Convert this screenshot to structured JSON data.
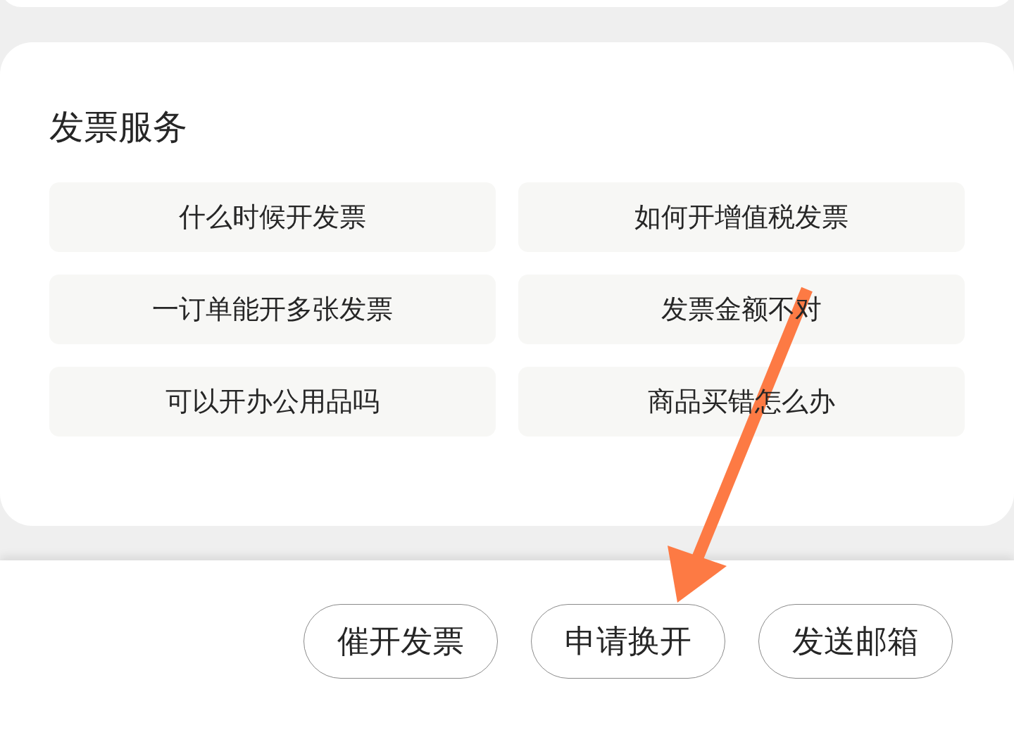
{
  "section": {
    "title": "发票服务",
    "items": [
      "什么时候开发票",
      "如何开增值税发票",
      "一订单能开多张发票",
      "发票金额不对",
      "可以开办公用品吗",
      "商品买错怎么办"
    ]
  },
  "actions": [
    "催开发票",
    "申请换开",
    "发送邮箱"
  ]
}
